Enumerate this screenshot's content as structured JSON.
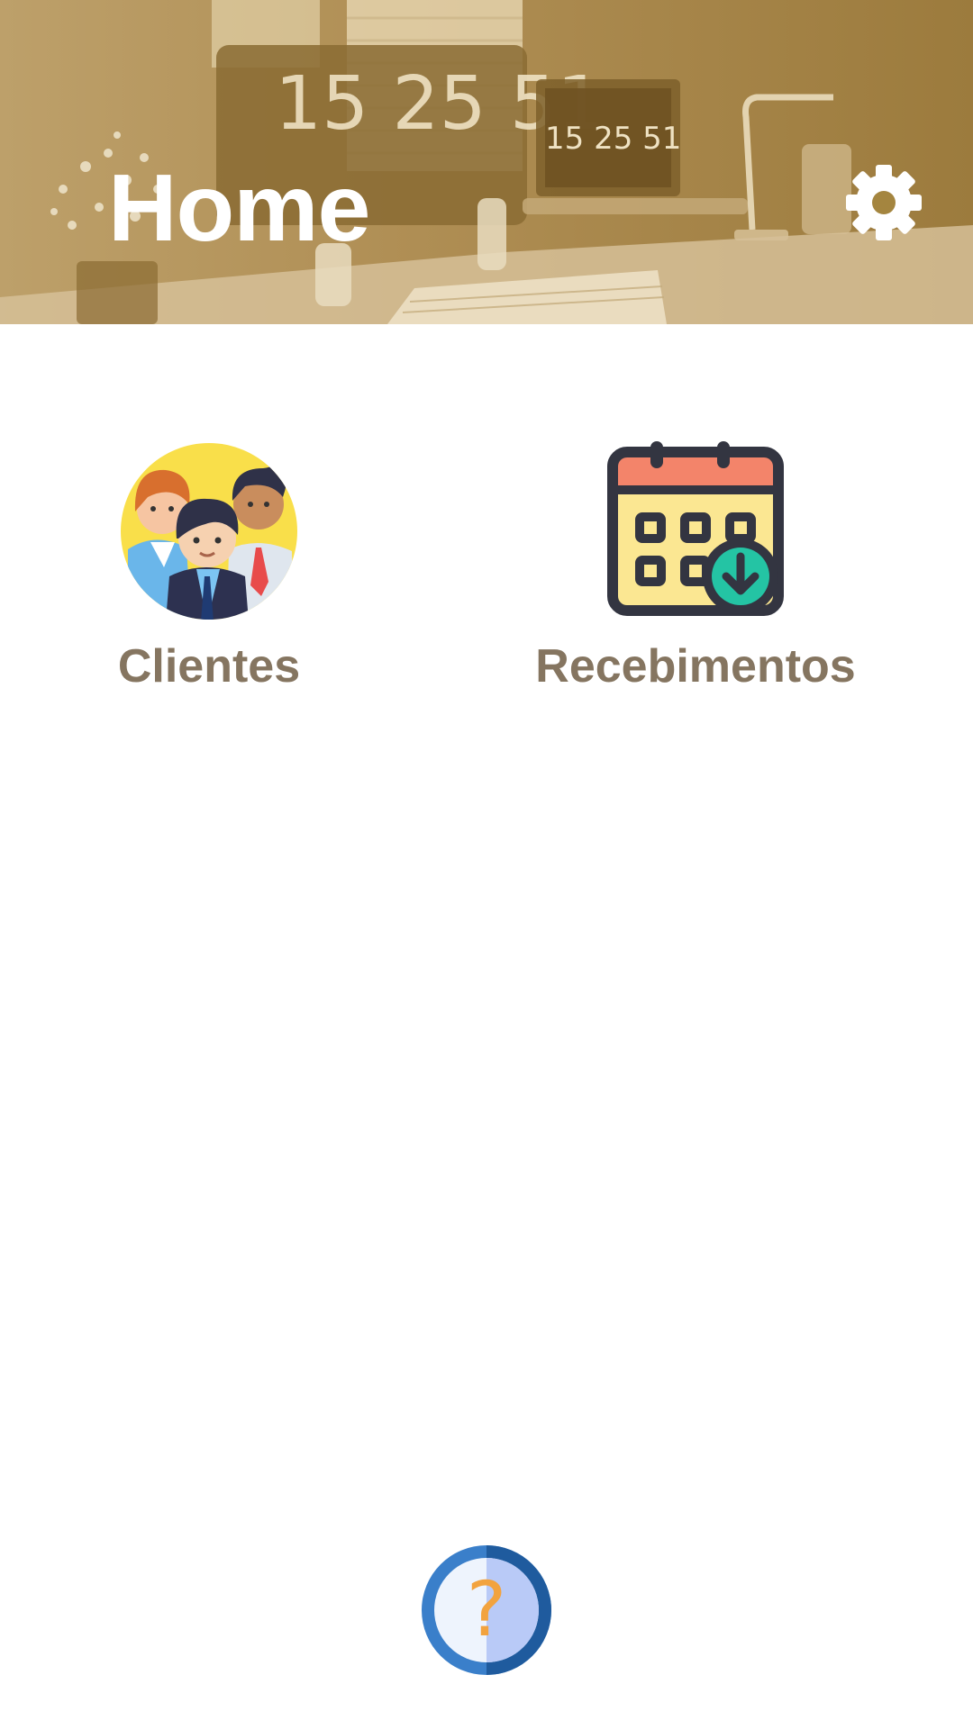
{
  "header": {
    "title": "Home",
    "settings_icon": "gear-icon",
    "background": "desk-photo-sepia",
    "clock_text_large": "15 25 51",
    "clock_text_small": "15 25 51"
  },
  "tiles": [
    {
      "label": "Clientes",
      "icon": "people-icon"
    },
    {
      "label": "Recebimentos",
      "icon": "calendar-download-icon"
    }
  ],
  "help_button": {
    "text": "?",
    "icon": "question-icon"
  },
  "colors": {
    "header_tint": "#b08f55",
    "tile_label": "#857560",
    "help_blue": "#2f6db4"
  }
}
